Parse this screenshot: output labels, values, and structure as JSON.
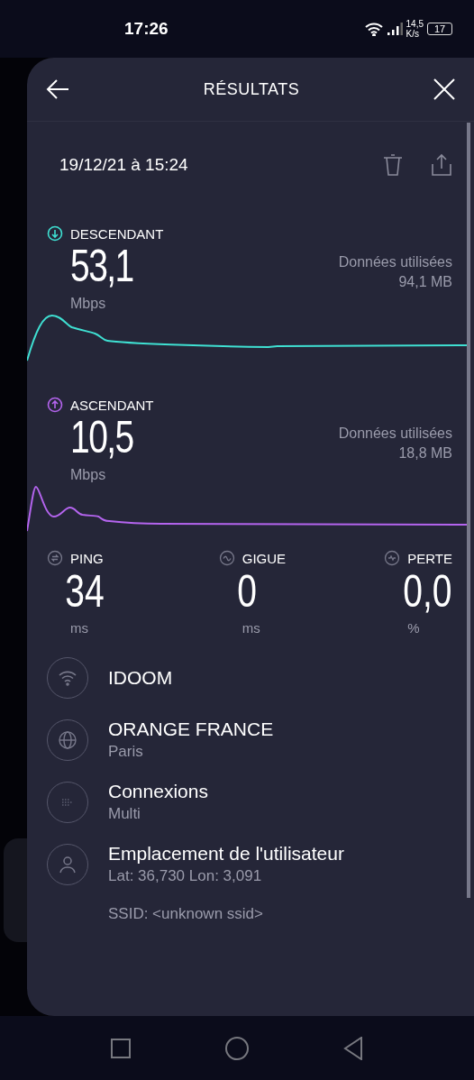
{
  "status_bar": {
    "time": "17:26",
    "net_speed": "14,5",
    "net_unit": "K/s",
    "battery": "17"
  },
  "header": {
    "title": "RÉSULTATS"
  },
  "test": {
    "date": "19/12/21 à 15:24"
  },
  "results": [
    {
      "kind": "download",
      "label": "DESCENDANT",
      "value": "53,1",
      "unit": "Mbps",
      "data_label": "Données utilisées",
      "data_value": "94,1 MB",
      "color": "#3fe0d2"
    },
    {
      "kind": "upload",
      "label": "ASCENDANT",
      "value": "10,5",
      "unit": "Mbps",
      "data_label": "Données utilisées",
      "data_value": "18,8 MB",
      "color": "#b464ee"
    }
  ],
  "metrics": [
    {
      "kind": "ping",
      "label": "PING",
      "value": "34",
      "unit": "ms"
    },
    {
      "kind": "jitter",
      "label": "GIGUE",
      "value": "0",
      "unit": "ms"
    },
    {
      "kind": "loss",
      "label": "PERTE",
      "value": "0,0",
      "unit": "%"
    }
  ],
  "details": [
    {
      "kind": "wifi",
      "title": "IDOOM"
    },
    {
      "kind": "server",
      "title": "ORANGE FRANCE",
      "subtitle": "Paris"
    },
    {
      "kind": "connections",
      "title": "Connexions",
      "subtitle": "Multi"
    },
    {
      "kind": "location",
      "title": "Emplacement de l'utilisateur",
      "subtitle": "Lat: 36,730 Lon: 3,091"
    }
  ],
  "ssid": "SSID: <unknown ssid>"
}
